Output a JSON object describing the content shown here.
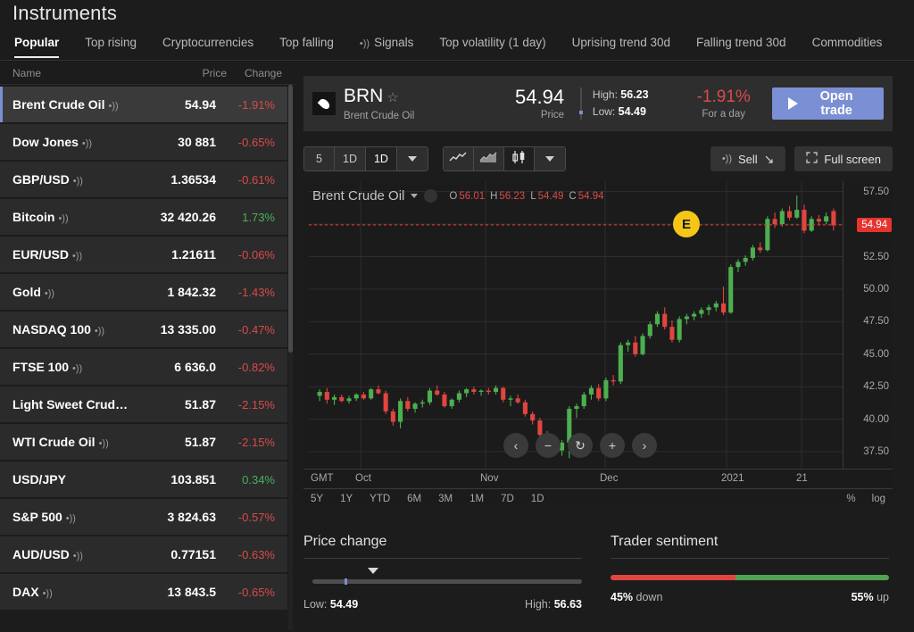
{
  "header": {
    "title": "Instruments"
  },
  "tabs": [
    {
      "label": "Popular",
      "active": true,
      "icon": null
    },
    {
      "label": "Top rising",
      "active": false,
      "icon": null
    },
    {
      "label": "Cryptocurrencies",
      "active": false,
      "icon": null
    },
    {
      "label": "Top falling",
      "active": false,
      "icon": null
    },
    {
      "label": "Signals",
      "active": false,
      "icon": "speaker-icon"
    },
    {
      "label": "Top volatility (1 day)",
      "active": false,
      "icon": null
    },
    {
      "label": "Uprising trend 30d",
      "active": false,
      "icon": null
    },
    {
      "label": "Falling trend 30d",
      "active": false,
      "icon": null
    },
    {
      "label": "Commodities",
      "active": false,
      "icon": null
    }
  ],
  "list": {
    "columns": {
      "name": "Name",
      "price": "Price",
      "change": "Change"
    },
    "rows": [
      {
        "name": "Brent Crude Oil",
        "speaker": true,
        "price": "54.94",
        "change": "-1.91%",
        "dir": "neg",
        "selected": true
      },
      {
        "name": "Dow Jones",
        "speaker": true,
        "price": "30 881",
        "change": "-0.65%",
        "dir": "neg",
        "selected": false
      },
      {
        "name": "GBP/USD",
        "speaker": true,
        "price": "1.36534",
        "change": "-0.61%",
        "dir": "neg",
        "selected": false
      },
      {
        "name": "Bitcoin",
        "speaker": true,
        "price": "32 420.26",
        "change": "1.73%",
        "dir": "pos",
        "selected": false
      },
      {
        "name": "EUR/USD",
        "speaker": true,
        "price": "1.21611",
        "change": "-0.06%",
        "dir": "neg",
        "selected": false
      },
      {
        "name": "Gold",
        "speaker": true,
        "price": "1 842.32",
        "change": "-1.43%",
        "dir": "neg",
        "selected": false
      },
      {
        "name": "NASDAQ 100",
        "speaker": true,
        "price": "13 335.00",
        "change": "-0.47%",
        "dir": "neg",
        "selected": false
      },
      {
        "name": "FTSE 100",
        "speaker": true,
        "price": "6 636.0",
        "change": "-0.82%",
        "dir": "neg",
        "selected": false
      },
      {
        "name": "Light Sweet Crude …",
        "speaker": false,
        "price": "51.87",
        "change": "-2.15%",
        "dir": "neg",
        "selected": false
      },
      {
        "name": "WTI Crude Oil",
        "speaker": true,
        "price": "51.87",
        "change": "-2.15%",
        "dir": "neg",
        "selected": false
      },
      {
        "name": "USD/JPY",
        "speaker": false,
        "price": "103.851",
        "change": "0.34%",
        "dir": "pos",
        "selected": false
      },
      {
        "name": "S&P 500",
        "speaker": true,
        "price": "3 824.63",
        "change": "-0.57%",
        "dir": "neg",
        "selected": false
      },
      {
        "name": "AUD/USD",
        "speaker": true,
        "price": "0.77151",
        "change": "-0.63%",
        "dir": "neg",
        "selected": false
      },
      {
        "name": "DAX",
        "speaker": true,
        "price": "13 843.5",
        "change": "-0.65%",
        "dir": "neg",
        "selected": false
      }
    ]
  },
  "instrument": {
    "ticker": "BRN",
    "full_name": "Brent Crude Oil",
    "price": "54.94",
    "price_label": "Price",
    "high_label": "High:",
    "high": "56.23",
    "low_label": "Low:",
    "low": "54.49",
    "change": "-1.91%",
    "change_label": "For a day",
    "open_trade_label": "Open trade",
    "icon": "oil-drop-icon",
    "favorite_icon": "star-icon"
  },
  "toolbar": {
    "timeframes": [
      {
        "label": "5",
        "active": false
      },
      {
        "label": "1D",
        "active": false
      },
      {
        "label": "1D",
        "active": true
      }
    ],
    "chart_types": [
      {
        "icon": "line-chart-icon",
        "active": false
      },
      {
        "icon": "area-chart-icon",
        "active": false
      },
      {
        "icon": "candlestick-chart-icon",
        "active": true
      }
    ],
    "sell_label": "Sell",
    "fullscreen_label": "Full screen"
  },
  "chart": {
    "name": "Brent Crude Oil",
    "ohlc": {
      "o_label": "O",
      "o": "56.01",
      "h_label": "H",
      "h": "56.23",
      "l_label": "L",
      "l": "54.49",
      "c_label": "C",
      "c": "54.94"
    },
    "current_price": "54.94",
    "timezone": "GMT",
    "event_marker": "E",
    "nav_buttons": [
      {
        "icon": "chevron-left-icon",
        "label": "‹"
      },
      {
        "icon": "minus-icon",
        "label": "−"
      },
      {
        "icon": "reset-icon",
        "label": "↻"
      },
      {
        "icon": "plus-icon",
        "label": "+"
      },
      {
        "icon": "chevron-right-icon",
        "label": "›"
      }
    ],
    "ranges": [
      "5Y",
      "1Y",
      "YTD",
      "6M",
      "3M",
      "1M",
      "7D",
      "1D"
    ],
    "range_right": [
      "%",
      "log"
    ]
  },
  "chart_data": {
    "type": "line",
    "title": "Brent Crude Oil",
    "xlabel": "",
    "ylabel": "",
    "ylim": [
      36.2,
      58.3
    ],
    "yticks": [
      57.5,
      55.0,
      52.5,
      50.0,
      47.5,
      45.0,
      42.5,
      40.0,
      37.5
    ],
    "ytick_labels": [
      "57.50",
      "55.00",
      "52.50",
      "50.00",
      "47.50",
      "45.00",
      "42.50",
      "40.00",
      "37.50"
    ],
    "xticks": [
      "Oct",
      "Nov",
      "Dec",
      "2021",
      "21"
    ],
    "grid": true,
    "legend": "none",
    "current_price_line": 54.94,
    "ohlc_series": [
      [
        41.8,
        42.3,
        41.4,
        42.1
      ],
      [
        42.1,
        42.4,
        41.2,
        41.5
      ],
      [
        41.5,
        41.9,
        41.1,
        41.7
      ],
      [
        41.7,
        41.9,
        41.3,
        41.4
      ],
      [
        41.4,
        41.8,
        41.2,
        41.6
      ],
      [
        41.6,
        42.0,
        41.4,
        41.9
      ],
      [
        41.9,
        42.1,
        41.5,
        41.6
      ],
      [
        41.6,
        42.4,
        41.5,
        42.3
      ],
      [
        42.3,
        42.6,
        41.9,
        42.0
      ],
      [
        42.0,
        42.2,
        40.4,
        40.6
      ],
      [
        40.6,
        40.8,
        39.5,
        39.8
      ],
      [
        39.8,
        41.6,
        39.3,
        41.4
      ],
      [
        41.4,
        41.7,
        40.6,
        40.8
      ],
      [
        40.8,
        41.3,
        40.5,
        41.2
      ],
      [
        41.2,
        41.5,
        40.9,
        41.3
      ],
      [
        41.3,
        42.4,
        41.1,
        42.2
      ],
      [
        42.2,
        42.6,
        41.8,
        41.9
      ],
      [
        41.9,
        42.1,
        40.9,
        41.0
      ],
      [
        41.0,
        41.6,
        40.8,
        41.5
      ],
      [
        41.5,
        42.2,
        41.3,
        42.0
      ],
      [
        42.0,
        42.4,
        41.7,
        42.3
      ],
      [
        42.3,
        42.5,
        41.9,
        42.1
      ],
      [
        42.1,
        42.3,
        41.8,
        42.2
      ],
      [
        42.2,
        42.4,
        41.9,
        42.1
      ],
      [
        42.1,
        42.6,
        41.9,
        42.4
      ],
      [
        42.4,
        42.5,
        41.3,
        41.5
      ],
      [
        41.5,
        41.8,
        41.0,
        41.6
      ],
      [
        41.6,
        41.9,
        41.2,
        41.3
      ],
      [
        41.3,
        41.5,
        40.2,
        40.4
      ],
      [
        40.4,
        40.6,
        39.6,
        39.9
      ],
      [
        39.9,
        40.1,
        38.6,
        38.8
      ],
      [
        38.8,
        39.1,
        37.8,
        38.0
      ],
      [
        38.0,
        38.3,
        37.4,
        37.6
      ],
      [
        37.6,
        38.4,
        37.2,
        38.2
      ],
      [
        38.2,
        41.0,
        37.0,
        40.8
      ],
      [
        40.8,
        41.2,
        40.1,
        41.0
      ],
      [
        41.0,
        42.1,
        40.8,
        41.9
      ],
      [
        41.9,
        42.6,
        41.5,
        42.4
      ],
      [
        42.4,
        42.7,
        41.4,
        41.6
      ],
      [
        41.6,
        43.2,
        41.4,
        43.0
      ],
      [
        43.0,
        43.4,
        42.6,
        42.9
      ],
      [
        42.9,
        45.9,
        42.7,
        45.7
      ],
      [
        45.7,
        46.1,
        45.2,
        45.9
      ],
      [
        45.9,
        46.4,
        44.8,
        45.0
      ],
      [
        45.0,
        46.6,
        44.9,
        46.4
      ],
      [
        46.4,
        47.5,
        46.2,
        47.3
      ],
      [
        47.3,
        48.3,
        47.1,
        48.1
      ],
      [
        48.1,
        48.6,
        46.9,
        47.1
      ],
      [
        47.1,
        47.6,
        45.9,
        46.1
      ],
      [
        46.1,
        47.9,
        45.9,
        47.7
      ],
      [
        47.7,
        48.1,
        47.3,
        47.9
      ],
      [
        47.9,
        48.3,
        47.6,
        48.1
      ],
      [
        48.1,
        48.6,
        47.8,
        48.4
      ],
      [
        48.4,
        48.8,
        48.0,
        48.6
      ],
      [
        48.6,
        49.1,
        48.3,
        48.9
      ],
      [
        48.9,
        50.2,
        48.0,
        48.2
      ],
      [
        48.2,
        51.9,
        48.1,
        51.7
      ],
      [
        51.7,
        52.3,
        51.3,
        52.1
      ],
      [
        52.1,
        52.6,
        51.8,
        52.4
      ],
      [
        52.4,
        53.4,
        52.2,
        53.2
      ],
      [
        53.2,
        53.6,
        52.8,
        53.0
      ],
      [
        53.0,
        55.6,
        52.9,
        55.4
      ],
      [
        55.4,
        55.9,
        54.7,
        55.0
      ],
      [
        55.0,
        56.2,
        54.8,
        56.0
      ],
      [
        56.0,
        56.4,
        55.3,
        55.5
      ],
      [
        55.5,
        57.2,
        55.4,
        56.1
      ],
      [
        56.1,
        56.5,
        54.3,
        54.5
      ],
      [
        54.5,
        55.6,
        54.4,
        55.4
      ],
      [
        55.4,
        55.7,
        54.9,
        55.2
      ],
      [
        55.2,
        55.9,
        55.0,
        55.6
      ],
      [
        56.0,
        56.2,
        54.5,
        54.9
      ]
    ]
  },
  "price_change_panel": {
    "title": "Price change",
    "low_label": "Low:",
    "low": "54.49",
    "high_label": "High:",
    "high": "56.63"
  },
  "sentiment_panel": {
    "title": "Trader sentiment",
    "down_pct": "45%",
    "down_label": "down",
    "up_pct": "55%",
    "up_label": "up",
    "down_value": 45,
    "up_value": 55
  },
  "colors": {
    "accent": "#7b8fd4",
    "negative": "#d94a4a",
    "positive": "#49b15a",
    "bullish_candle": "#4caf50",
    "bearish_candle": "#e0453f",
    "price_tag": "#e5342e",
    "event_marker": "#f5c518"
  }
}
